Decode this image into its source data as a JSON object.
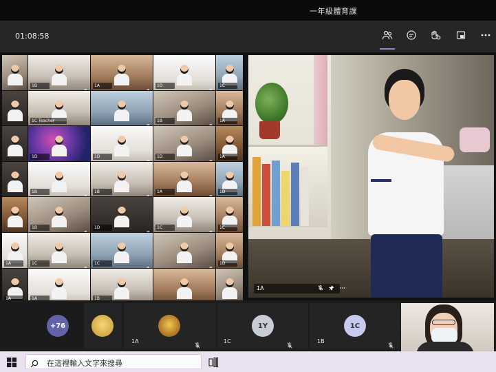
{
  "window": {
    "title": "一年級體育課"
  },
  "toolbar": {
    "timer": "01:08:58",
    "buttons": [
      {
        "name": "participants-icon",
        "active": true
      },
      {
        "name": "chat-icon",
        "active": false
      },
      {
        "name": "reactions-icon",
        "active": false
      },
      {
        "name": "share-icon",
        "active": false
      },
      {
        "name": "more-icon",
        "active": false
      }
    ]
  },
  "grid": {
    "tiles": [
      {
        "label": "",
        "look": "v-room",
        "mic": false
      },
      {
        "label": "1B",
        "look": "v-bright",
        "mic": true
      },
      {
        "label": "1A",
        "look": "v-warm",
        "mic": true
      },
      {
        "label": "1D",
        "look": "v-white",
        "mic": true
      },
      {
        "label": "1C",
        "look": "v-blue",
        "mic": false
      },
      {
        "label": "",
        "look": "v-dark",
        "mic": false
      },
      {
        "label": "1C Teacher",
        "look": "v-bright",
        "mic": false
      },
      {
        "label": "",
        "look": "v-blue",
        "mic": true
      },
      {
        "label": "1B",
        "look": "v-room",
        "mic": true
      },
      {
        "label": "1A",
        "look": "v-warm",
        "mic": false
      },
      {
        "label": "",
        "look": "v-dark",
        "mic": false
      },
      {
        "label": "1D",
        "look": "v-space",
        "mic": false
      },
      {
        "label": "1D",
        "look": "v-white",
        "mic": true
      },
      {
        "label": "1D",
        "look": "v-room",
        "mic": true
      },
      {
        "label": "1A",
        "look": "v-wood",
        "mic": false
      },
      {
        "label": "",
        "look": "v-dark",
        "mic": false
      },
      {
        "label": "1B",
        "look": "v-white",
        "mic": true
      },
      {
        "label": "1B",
        "look": "v-bright",
        "mic": true
      },
      {
        "label": "1A",
        "look": "v-warm",
        "mic": true
      },
      {
        "label": "1D",
        "look": "v-blue",
        "mic": false
      },
      {
        "label": "",
        "look": "v-wood",
        "mic": false
      },
      {
        "label": "1B",
        "look": "v-room",
        "mic": true
      },
      {
        "label": "1D",
        "look": "v-dark",
        "mic": true
      },
      {
        "label": "1C",
        "look": "v-bright",
        "mic": true
      },
      {
        "label": "1C",
        "look": "v-warm",
        "mic": false
      },
      {
        "label": "1A",
        "look": "v-white",
        "mic": false
      },
      {
        "label": "1C",
        "look": "v-bright",
        "mic": true
      },
      {
        "label": "1C",
        "look": "v-blue",
        "mic": true
      },
      {
        "label": "",
        "look": "v-room",
        "mic": true
      },
      {
        "label": "1D",
        "look": "v-warm",
        "mic": false
      },
      {
        "label": "1A",
        "look": "v-dark",
        "mic": false
      },
      {
        "label": "1A",
        "look": "v-white",
        "mic": true
      },
      {
        "label": "1B",
        "look": "v-bright",
        "mic": true
      },
      {
        "label": "",
        "look": "v-warm",
        "mic": true
      },
      {
        "label": "",
        "look": "v-room",
        "mic": false
      }
    ]
  },
  "spotlight": {
    "label": "1A"
  },
  "strip": {
    "overflow_count": "+76",
    "participants": [
      {
        "label": "1A",
        "initials": "",
        "avatar_color": "#c9a14a"
      },
      {
        "label": "1C",
        "initials": "1Y",
        "avatar_color": "#c7ccd6"
      },
      {
        "label": "1B",
        "initials": "1C",
        "avatar_color": "#c7c9ef"
      }
    ]
  },
  "taskbar": {
    "search_placeholder": "在這裡輸入文字來搜尋"
  },
  "colors": {
    "accent": "#8b8cc7",
    "overflow_badge": "#6264a7"
  }
}
